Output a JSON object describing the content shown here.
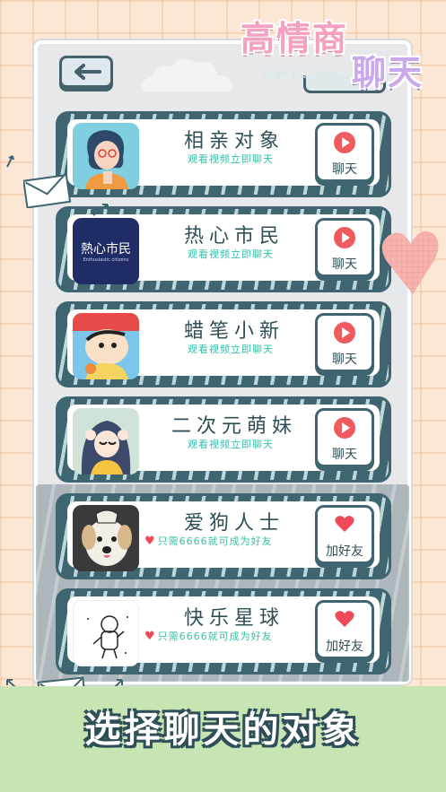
{
  "app": {
    "logo_line1": "高情商",
    "logo_line2": "聊天",
    "logo_sub": "High EQ Chat"
  },
  "cards": [
    {
      "title": "相亲对象",
      "subtitle": "观看视频立即聊天",
      "action": "聊天",
      "type": "video"
    },
    {
      "title": "热心市民",
      "subtitle": "观看视频立即聊天",
      "action": "聊天",
      "type": "video",
      "avatar_text": "熱心市民",
      "avatar_subtext": "Enthusiastic citizens"
    },
    {
      "title": "蜡笔小新",
      "subtitle": "观看视频立即聊天",
      "action": "聊天",
      "type": "video"
    },
    {
      "title": "二次元萌妹",
      "subtitle": "观看视频立即聊天",
      "action": "聊天",
      "type": "video"
    },
    {
      "title": "爱狗人士",
      "subtitle": "只需6666就可成为好友",
      "action": "加好友",
      "type": "friend"
    },
    {
      "title": "快乐星球",
      "subtitle": "只需6666就可成为好友",
      "action": "加好友",
      "type": "friend"
    }
  ],
  "banner": {
    "text": "选择聊天的对象"
  },
  "colors": {
    "card_border": "#3f6570",
    "play_red": "#ef5a5f",
    "heart_red": "#ef4a5a",
    "subtitle_green": "#35bfa7",
    "banner_bg": "#c9e4b3"
  }
}
